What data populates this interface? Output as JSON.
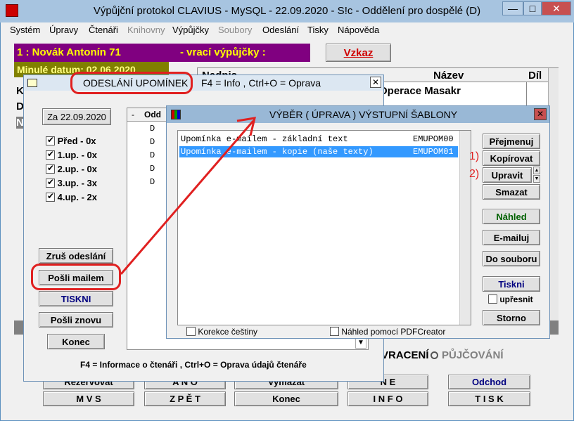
{
  "window": {
    "title": "Výpůjční protokol CLAVIUS - MySQL - 22.09.2020 - S!c - Oddělení pro dospělé (D)"
  },
  "menu": [
    "Systém",
    "Úpravy",
    "Čtenáři",
    "Knihovny",
    "Výpůjčky",
    "Soubory",
    "Odeslání",
    "Tisky",
    "Nápověda"
  ],
  "reader": {
    "label": "1 : Novák Antonín 71",
    "action": "- vrací výpůjčky :",
    "last_date": "Minulé datum: 02.06.2020",
    "vzkaz": "Vzkaz"
  },
  "main_table": {
    "headers": [
      "Nadpis",
      "Název",
      "Díl"
    ],
    "row1": "Operace Masakr"
  },
  "side_letters": [
    "K",
    "D",
    "N"
  ],
  "upominky": {
    "title": "ODESLÁNÍ UPOMÍNEK",
    "hint": "F4 = Info , Ctrl+O = Oprava",
    "date_btn": "Za 22.09.2020",
    "checks": [
      {
        "label": "Před - 0x"
      },
      {
        "label": "1.up. - 0x"
      },
      {
        "label": "2.up. - 0x"
      },
      {
        "label": "3.up. - 3x"
      },
      {
        "label": "4.up. - 2x"
      }
    ],
    "list_headers": [
      "-",
      "Odd"
    ],
    "list_rows": [
      "D",
      "D",
      "D",
      "D",
      "D"
    ],
    "buttons": {
      "zrus": "Zruš odeslání",
      "posli": "Pošli mailem",
      "tiskni": "TISKNI",
      "znovu": "Pošli znovu",
      "konec": "Konec"
    },
    "footer": "F4 = Informace o čtenáři , Ctrl+O = Oprava údajů čtenáře"
  },
  "sablony": {
    "title": "VÝBĚR ( ÚPRAVA ) VÝSTUPNÍ ŠABLONY",
    "items": [
      {
        "name": "Upomínka e-mailem - základní text",
        "code": "EMUPOM00"
      },
      {
        "name": "Upomínka e-mailem - kopie (naše texty)",
        "code": "EMUPOM01"
      }
    ],
    "buttons": {
      "prejmenuj": "Přejmenuj",
      "kopirovat": "Kopírovat",
      "upravit": "Upravit",
      "smazat": "Smazat",
      "nahled": "Náhled",
      "email": "E-mailuj",
      "soubor": "Do souboru",
      "tiskni": "Tiskni",
      "upresnit": "upřesnit",
      "storno": "Storno"
    },
    "marks": {
      "one": "1)",
      "two": "2)"
    },
    "check_korekce": "Korekce češtiny",
    "check_pdf": "Náhled pomocí PDFCreator"
  },
  "mode": {
    "vraceni": "VRACENÍ",
    "pujcovani": "PŮJČOVÁNÍ"
  },
  "bottom": {
    "row1": [
      "Rezervovat",
      "A N O",
      "Vymazat",
      "N E",
      "Odchod"
    ],
    "row2": [
      "M V S",
      "Z P Ě T",
      "Konec",
      "I N F O",
      "T I S K"
    ]
  },
  "colors": {
    "purple": "#800080",
    "olive": "#808000",
    "selection": "#3399ff",
    "alert": "#e02020"
  }
}
